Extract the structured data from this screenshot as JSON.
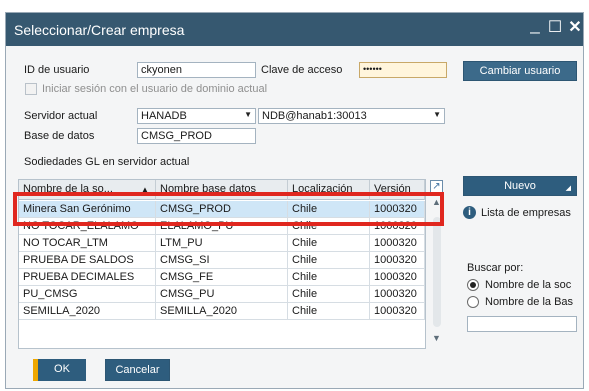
{
  "window": {
    "title": "Seleccionar/Crear empresa"
  },
  "form": {
    "user_id_label": "ID de usuario",
    "user_id_value": "ckyonen",
    "password_label": "Clave de acceso",
    "password_value": "••••••",
    "change_user_label": "Cambiar usuario",
    "domain_login_label": "Iniciar sesión con el usuario de dominio actual",
    "server_label": "Servidor actual",
    "server_type_value": "HANADB",
    "server_value": "NDB@hanab1:30013",
    "database_label": "Base de datos",
    "database_value": "CMSG_PROD",
    "companies_label": "Sodiedades GL en servidor actual"
  },
  "table": {
    "columns": [
      "Nombre de la so...",
      "Nombre base datos",
      "Localización",
      "Versión"
    ],
    "sort_indicator": "▲",
    "rows": [
      [
        "Minera San Gerónimo",
        "CMSG_PROD",
        "Chile",
        "1000320"
      ],
      [
        "NO TOCAR_ELALAMO",
        "ELALAMO_PU",
        "Chile",
        "1000320"
      ],
      [
        "NO TOCAR_LTM",
        "LTM_PU",
        "Chile",
        "1000320"
      ],
      [
        "PRUEBA DE SALDOS",
        "CMSG_SI",
        "Chile",
        "1000320"
      ],
      [
        "PRUEBA DECIMALES",
        "CMSG_FE",
        "Chile",
        "1000320"
      ],
      [
        "PU_CMSG",
        "CMSG_PU",
        "Chile",
        "1000320"
      ],
      [
        "SEMILLA_2020",
        "SEMILLA_2020",
        "Chile",
        "1000320"
      ]
    ]
  },
  "side": {
    "new_label": "Nuevo",
    "company_list_label": "Lista de empresas",
    "search_label": "Buscar por:",
    "radio_company_name": "Nombre de la soc",
    "radio_db_name": "Nombre de la Bas"
  },
  "footer": {
    "ok_label": "OK",
    "cancel_label": "Cancelar"
  }
}
